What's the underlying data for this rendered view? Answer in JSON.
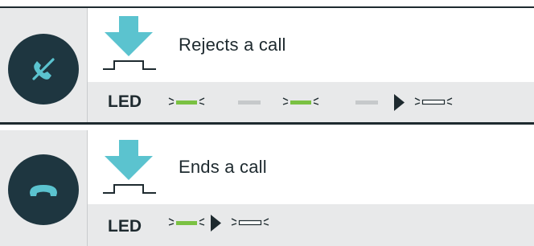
{
  "rows": [
    {
      "button_icon": "reject-call-icon",
      "press_icon": "button-press-icon",
      "action": "Rejects a call",
      "led_label": "LED",
      "led_sequence": [
        "flash-green",
        "dim-gray",
        "flash-green",
        "dim-gray",
        "arrow-right",
        "flash-white"
      ]
    },
    {
      "button_icon": "end-call-icon",
      "press_icon": "button-press-icon",
      "action": "Ends a call",
      "led_label": "LED",
      "led_sequence": [
        "flash-green",
        "arrow-right",
        "flash-white"
      ]
    }
  ],
  "colors": {
    "accent_arrow": "#5bc3cf",
    "led_green": "#7ac143",
    "led_gray": "#c6c9cb",
    "button_bg": "#1e3640",
    "text": "#1e2a2f"
  }
}
